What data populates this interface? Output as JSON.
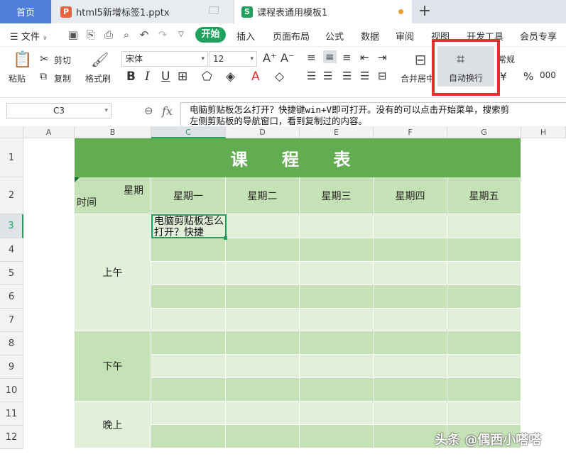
{
  "tabs": {
    "home": "首页",
    "ppt": "html5新增标签1.pptx",
    "xls": "课程表通用模板1",
    "ppt_icon": "P",
    "xls_icon": "S",
    "new_tab": "+"
  },
  "menu": {
    "file": "文件",
    "tabs": [
      "开始",
      "插入",
      "页面布局",
      "公式",
      "数据",
      "审阅",
      "视图",
      "开发工具",
      "会员专享"
    ]
  },
  "ribbon": {
    "paste": "粘贴",
    "cut": "剪切",
    "copy": "复制",
    "format_painter": "格式刷",
    "font_name": "宋体",
    "font_size": "12",
    "merge_center": "合并居中",
    "wrap_text": "自动换行",
    "number_format": "常规",
    "currency": "¥",
    "percent": "%",
    "thousands": "000",
    "bold": "B",
    "italic": "I",
    "underline": "U"
  },
  "formula_bar": {
    "cell_ref": "C3",
    "fx": "fx",
    "content_line1": "电脑剪贴板怎么打开？快捷键win+V即可打开。没有的可以点击开始菜单，搜索剪",
    "content_line2": "左侧剪贴板的导航窗口，看到复制过的内容。"
  },
  "columns": [
    "A",
    "B",
    "C",
    "D",
    "E",
    "F",
    "G",
    "H"
  ],
  "rows": [
    "1",
    "2",
    "3",
    "4",
    "5",
    "6",
    "7",
    "8",
    "9",
    "10",
    "11",
    "12"
  ],
  "sheet": {
    "title": "课 程 表",
    "corner_top": "星期",
    "corner_bottom": "时间",
    "weekdays": [
      "星期一",
      "星期二",
      "星期三",
      "星期四",
      "星期五"
    ],
    "periods": [
      "上午",
      "下午",
      "晚上"
    ],
    "active_cell_text": "电脑剪贴板怎么打开？快捷"
  },
  "watermark": "头条 @偶西小嗒嗒",
  "colors": {
    "accent_green": "#1fa35c",
    "title_green": "#62ac51",
    "highlight_red": "#e2312f",
    "home_tab_blue": "#4d7fd6"
  }
}
